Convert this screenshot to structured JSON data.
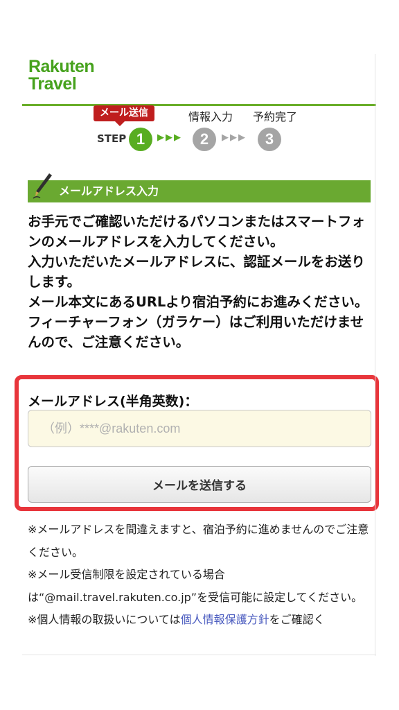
{
  "brand": {
    "line1": "Rakuten",
    "line2": "Travel"
  },
  "steps": {
    "badge": "メール送信",
    "step_word": "STEP",
    "labels": [
      "情報入力",
      "予約完了"
    ],
    "numbers": [
      "1",
      "2",
      "3"
    ],
    "arrows": "▶▶▶",
    "current_step": 1
  },
  "section": {
    "heading": "メールアドレス入力",
    "intro": [
      "お手元でご確認いただけるパソコンまたはスマートフォンのメールアドレスを入力してください。",
      "入力いただいたメールアドレスに、認証メールをお送りします。",
      "メール本文にあるURLより宿泊予約にお進みください。",
      "フィーチャーフォン（ガラケー）はご利用いただけませんので、ご注意ください。"
    ]
  },
  "form": {
    "email_label": "メールアドレス(半角英数)：",
    "email_placeholder": "（例）****@rakuten.com",
    "email_value": "",
    "send_button": "メールを送信する"
  },
  "notes": {
    "note1": "※メールアドレスを間違えますと、宿泊予約に進めませんのでご注意ください。",
    "note2": "※メール受信制限を設定されている場合は“@mail.travel.rakuten.co.jp”を受信可能に設定してください。",
    "note3_prefix": "※個人情報の取扱いについては",
    "note3_link": "個人情報保護方針",
    "note3_suffix": "をご確認く"
  },
  "colors": {
    "brand_green": "#46a21d",
    "step_active": "#58ad21",
    "step_inactive": "#a5a5a5",
    "badge_red": "#bf1e1e",
    "highlight_red": "#e8353b",
    "link_blue": "#4a5bbf"
  }
}
